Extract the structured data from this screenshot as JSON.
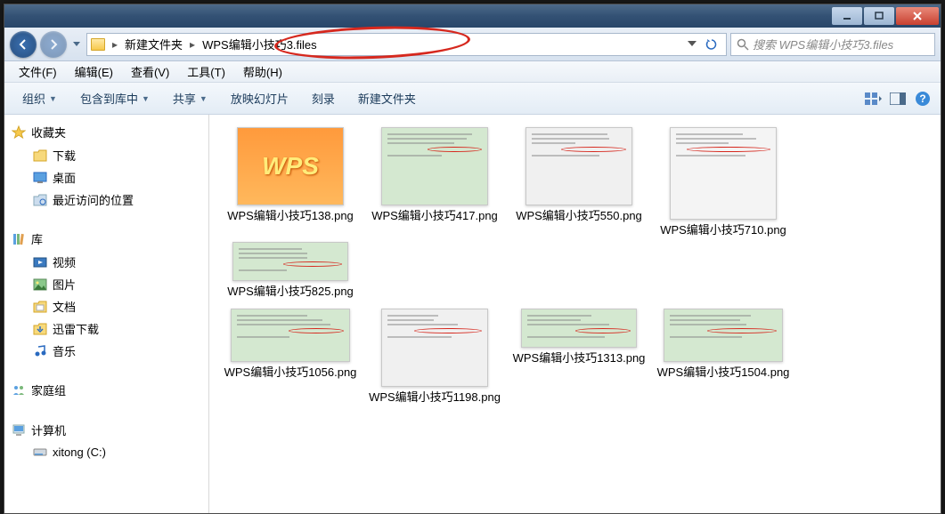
{
  "titlebar": {},
  "nav": {
    "breadcrumb": [
      {
        "label": "新建文件夹"
      },
      {
        "label": "WPS编辑小技巧3.files"
      }
    ]
  },
  "search": {
    "placeholder": "搜索 WPS编辑小技巧3.files"
  },
  "menubar": [
    "文件(F)",
    "编辑(E)",
    "查看(V)",
    "工具(T)",
    "帮助(H)"
  ],
  "toolbar": {
    "organize": "组织",
    "include": "包含到库中",
    "share": "共享",
    "slideshow": "放映幻灯片",
    "burn": "刻录",
    "newfolder": "新建文件夹"
  },
  "sidebar": {
    "favorites": {
      "title": "收藏夹",
      "items": [
        "下载",
        "桌面",
        "最近访问的位置"
      ]
    },
    "library": {
      "title": "库",
      "items": [
        "视频",
        "图片",
        "文档",
        "迅雷下载",
        "音乐"
      ]
    },
    "homegroup": {
      "title": "家庭组"
    },
    "computer": {
      "title": "计算机",
      "items": [
        "xitong (C:)"
      ]
    }
  },
  "files_row1": [
    {
      "name": "WPS编辑小技巧138.png",
      "cls": "wps",
      "txt": "WPS"
    },
    {
      "name": "WPS编辑小技巧417.png",
      "cls": "",
      "txt": ""
    },
    {
      "name": "WPS编辑小技巧550.png",
      "cls": "ui",
      "txt": ""
    },
    {
      "name": "WPS编辑小技巧710.png",
      "cls": "tall",
      "txt": ""
    },
    {
      "name": "WPS编辑小技巧825.png",
      "cls": "sm",
      "txt": ""
    }
  ],
  "files_row2": [
    {
      "name": "WPS编辑小技巧1056.png",
      "cls": "row2a",
      "txt": ""
    },
    {
      "name": "WPS编辑小技巧1198.png",
      "cls": "ui",
      "txt": ""
    },
    {
      "name": "WPS编辑小技巧1313.png",
      "cls": "sm",
      "txt": ""
    },
    {
      "name": "WPS编辑小技巧1504.png",
      "cls": "row2a",
      "txt": ""
    }
  ]
}
